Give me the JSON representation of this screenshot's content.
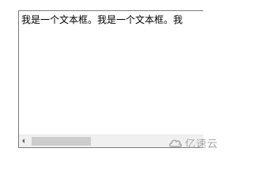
{
  "textbox": {
    "value": "我是一个文本框。我是一个文本框。我"
  },
  "watermark": {
    "text": "亿速云",
    "icon": "cloud-logo-icon"
  },
  "colors": {
    "border": "#7a7a7a",
    "scrollbar_track": "#f0f0f0",
    "scrollbar_thumb": "#cdcdcd",
    "watermark": "#a7a7a7"
  }
}
